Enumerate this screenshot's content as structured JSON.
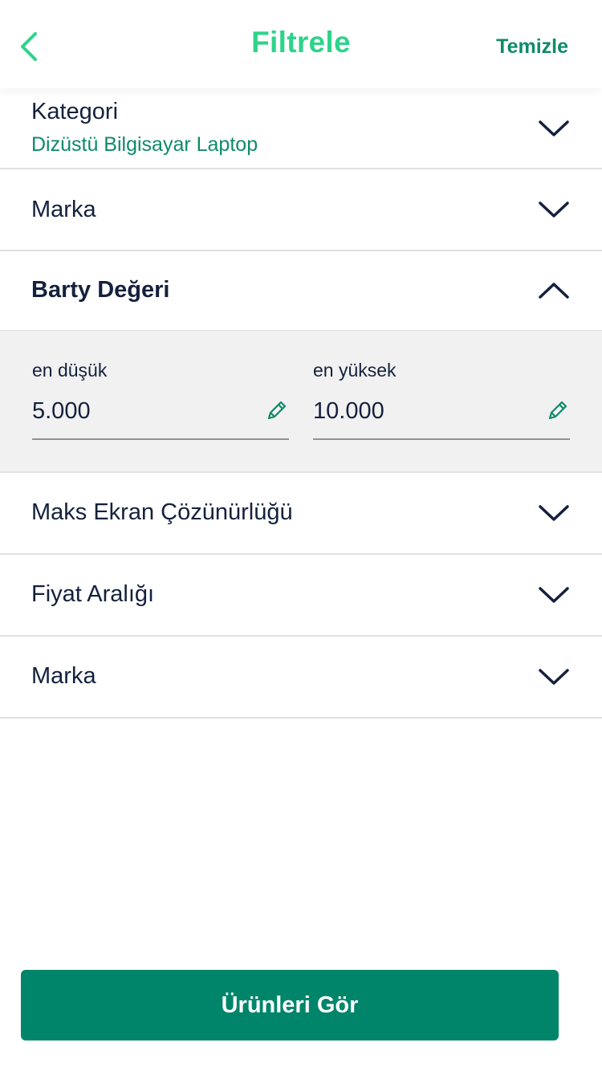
{
  "header": {
    "title": "Filtrele",
    "clear_label": "Temizle",
    "back_icon": "chevron-left-icon"
  },
  "filters": {
    "category": {
      "label": "Kategori",
      "value": "Dizüstü Bilgisayar Laptop"
    },
    "brand": {
      "label": "Marka"
    },
    "barty_value": {
      "label": "Barty Değeri",
      "expanded": true,
      "min_label": "en düşük",
      "min_value": "5.000",
      "max_label": "en yüksek",
      "max_value": "10.000"
    },
    "max_resolution": {
      "label": "Maks Ekran Çözünürlüğü"
    },
    "price_range": {
      "label": "Fiyat Aralığı"
    },
    "brand2": {
      "label": "Marka"
    }
  },
  "cta": {
    "label": "Ürünleri Gör"
  },
  "colors": {
    "title_green": "#2ed38a",
    "accent_green": "#0f8a6a",
    "button_green": "#00856a",
    "text_dark": "#14213d",
    "panel_bg": "#f1f1f1",
    "divider": "#e1e1e1"
  }
}
